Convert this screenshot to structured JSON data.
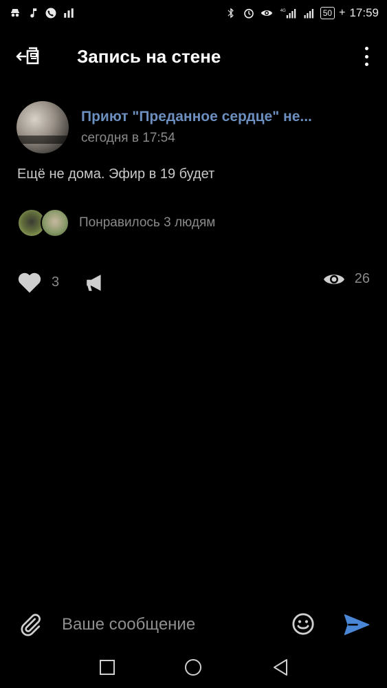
{
  "status_bar": {
    "time": "17:59",
    "battery": "50",
    "network": "4G",
    "left_icons": [
      "incognito-icon",
      "music-icon",
      "phone-icon",
      "signal-bars-icon"
    ],
    "right_icons": [
      "bluetooth-icon",
      "alarm-icon",
      "eye-icon",
      "network-signal-icon",
      "wifi-signal-icon",
      "battery-icon",
      "charging-icon"
    ]
  },
  "app_bar": {
    "title": "Запись на стене",
    "back_icon": "back-to-feed-icon",
    "menu_icon": "more-vertical-icon"
  },
  "post": {
    "author": "Приют \"Преданное сердце\" не...",
    "time": "сегодня в 17:54",
    "text": "Ещё не дома. Эфир в 19 будет",
    "likes_summary": "Понравилось 3 людям",
    "likes_count": "3",
    "views_count": "26"
  },
  "composer": {
    "placeholder": "Ваше сообщение",
    "attach_icon": "paperclip-icon",
    "emoji_icon": "smiley-icon",
    "send_icon": "send-icon"
  },
  "nav_bar": {
    "buttons": [
      "recent-apps-icon",
      "home-icon",
      "back-icon"
    ]
  },
  "colors": {
    "background": "#000000",
    "accent": "#6c8fbf",
    "send": "#4a86d6",
    "secondary_text": "#8a8a8a"
  }
}
